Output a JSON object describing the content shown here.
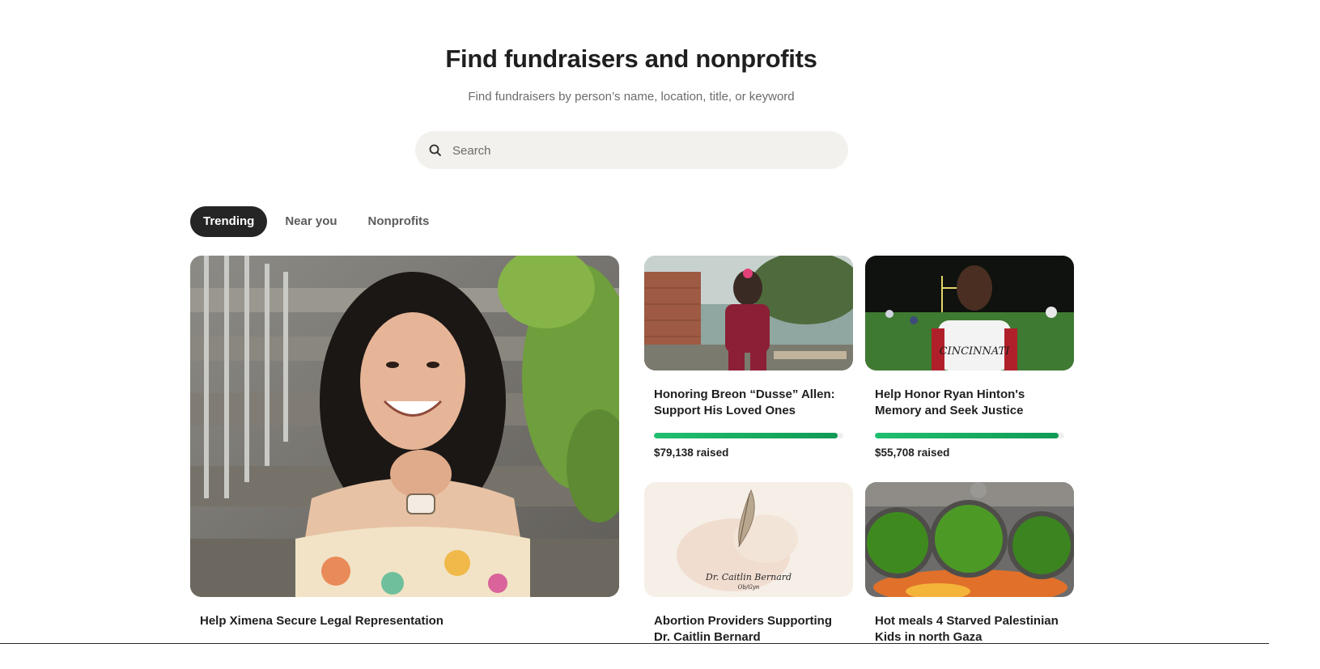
{
  "header": {
    "title": "Find fundraisers and nonprofits",
    "subtitle": "Find fundraisers by person’s name, location, title, or keyword"
  },
  "search": {
    "placeholder": "Search",
    "icon": "search-icon"
  },
  "tabs": [
    {
      "label": "Trending",
      "active": true
    },
    {
      "label": "Near you",
      "active": false
    },
    {
      "label": "Nonprofits",
      "active": false
    }
  ],
  "fundraisers": [
    {
      "title": "Help Ximena Secure Legal Representation",
      "image": "smiling young woman on stone steps"
    },
    {
      "title": "Honoring Breon “Dusse” Allen: Support His Loved Ones",
      "raised": "$79,138 raised",
      "progress": 0.97,
      "image": "young football player in maroon uniform"
    },
    {
      "title": "Help Honor Ryan Hinton's Memory and Seek Justice",
      "raised": "$55,708 raised",
      "progress": 0.97,
      "image": "teen in Cincinnati football jersey on field at night"
    },
    {
      "title": "Abortion Providers Supporting Dr. Caitlin Bernard",
      "image": "feather illustration",
      "image_text": {
        "name": "Dr. Caitlin Bernard",
        "role": "Ob/Gyn"
      }
    },
    {
      "title": "Hot meals 4 Starved Palestinian Kids in north Gaza",
      "image": "pots of green stew cooking over fire"
    }
  ],
  "colors": {
    "accent_green": "#1fbf6f",
    "active_tab_bg": "#252525",
    "search_bg": "#f2f1ed"
  }
}
